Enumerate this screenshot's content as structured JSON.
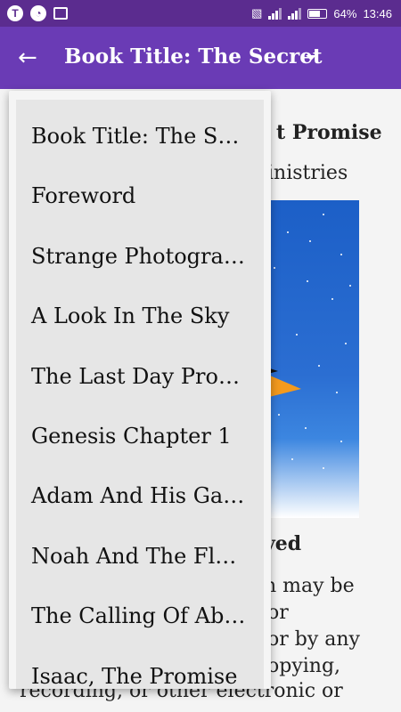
{
  "status_bar": {
    "battery_percent": "64%",
    "time": "13:46"
  },
  "toolbar": {
    "title": "Book Title: The Secret",
    "back_icon": "arrow-left-icon",
    "dropdown_icon": "caret-down-icon"
  },
  "background": {
    "line1": "t Promise",
    "line2": "inistries",
    "line3": "ved",
    "line4": "n may be",
    "line5": "or",
    "line6": "or by any",
    "line7": "opying,",
    "line8": "recording, or other electronic or"
  },
  "dropdown": {
    "items": [
      "Book Title: The Secret",
      "Foreword",
      "Strange Photographs",
      "A Look In The Sky",
      "The Last Day Promise",
      "Genesis Chapter 1",
      "Adam And His Garden",
      "Noah And The Flood",
      "The Calling Of Abraham",
      "Isaac, The Promise"
    ]
  },
  "colors": {
    "status_bar": "#5b2c8f",
    "toolbar": "#6a3bb5"
  }
}
